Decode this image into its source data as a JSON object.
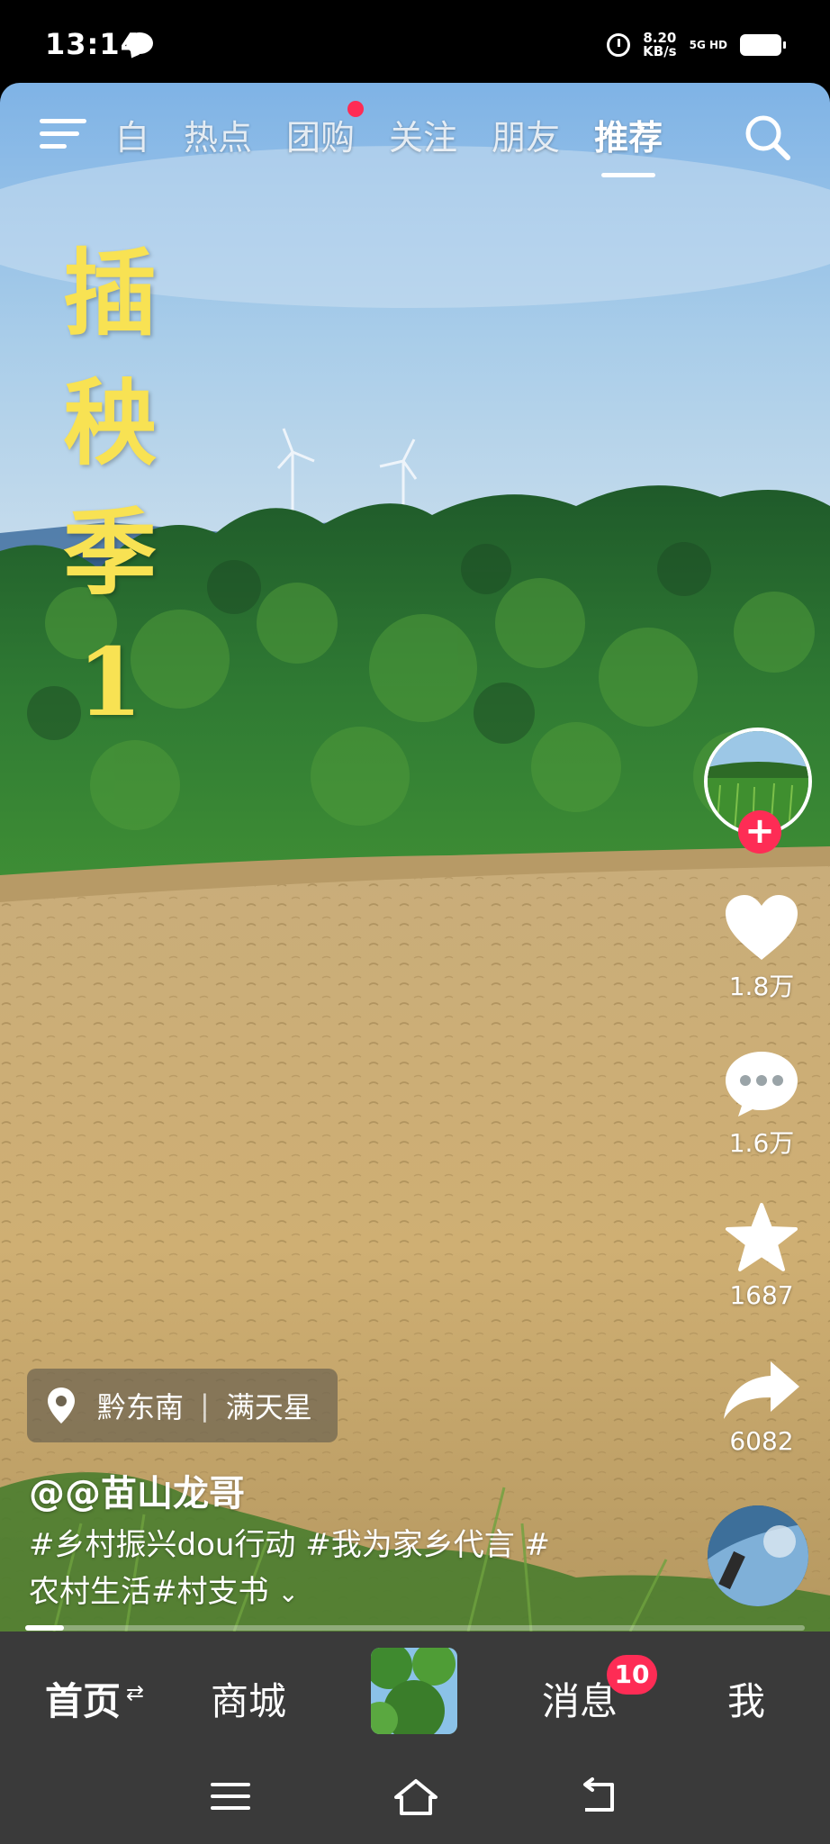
{
  "status_bar": {
    "time": "13:14",
    "speed_value": "8.20",
    "speed_unit": "KB/s",
    "network": "5G HD"
  },
  "top_nav": {
    "tabs": [
      {
        "label": "白"
      },
      {
        "label": "热点"
      },
      {
        "label": "团购",
        "has_dot": true
      },
      {
        "label": "关注"
      },
      {
        "label": "朋友"
      },
      {
        "label": "推荐",
        "active": true
      }
    ]
  },
  "video": {
    "title_chars": [
      "插",
      "秧",
      "季",
      "1"
    ],
    "title_color": "#f8e253"
  },
  "side_rail": {
    "like_count": "1.8万",
    "comment_count": "1.6万",
    "favorite_count": "1687",
    "share_count": "6082"
  },
  "post": {
    "location": "黔东南",
    "location_extra": "满天星",
    "username": "@@苗山龙哥",
    "caption_line1": "#乡村振兴dou行动 #我为家乡代言 #",
    "caption_line2": "农村生活#村支书",
    "progress": 0.05
  },
  "bottom_tabs": {
    "home": "首页",
    "mall": "商城",
    "messages": "消息",
    "me": "我",
    "message_badge": "10"
  },
  "colors": {
    "accent": "#fe2c55",
    "tab_bar": "#3a3a3a"
  }
}
